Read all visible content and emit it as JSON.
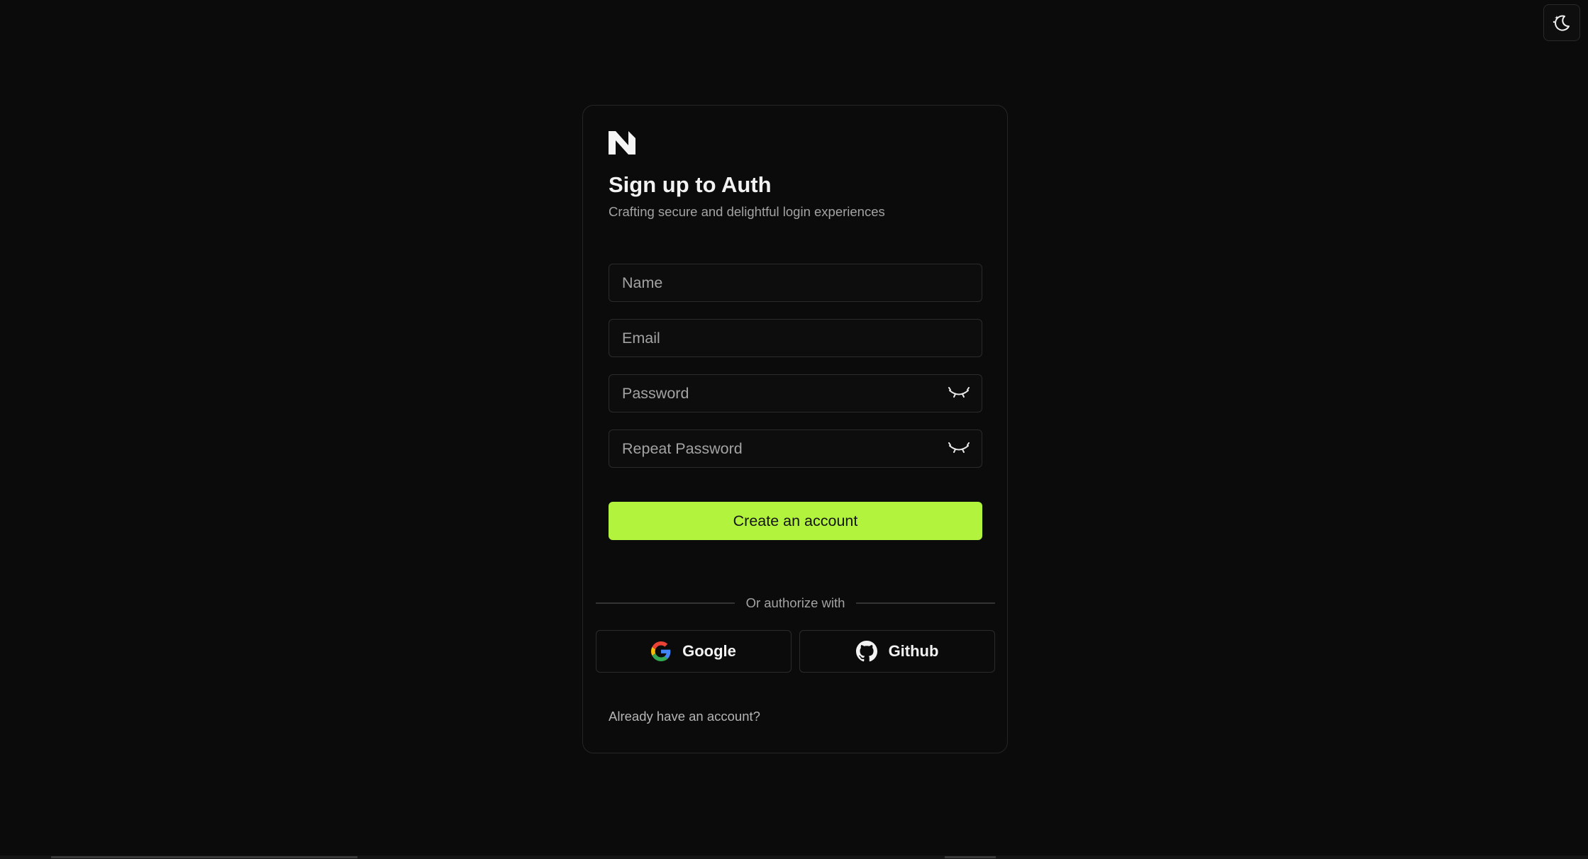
{
  "theme_toggle": {
    "icon": "moon-stars-icon"
  },
  "card": {
    "logo": {
      "icon": "brand-logo-icon"
    },
    "title": "Sign up to Auth",
    "subtitle": "Crafting secure and delightful login experiences"
  },
  "form": {
    "name": {
      "placeholder": "Name",
      "value": ""
    },
    "email": {
      "placeholder": "Email",
      "value": ""
    },
    "password": {
      "placeholder": "Password",
      "value": "",
      "toggle_icon": "eye-closed-icon"
    },
    "repeat_password": {
      "placeholder": "Repeat Password",
      "value": "",
      "toggle_icon": "eye-closed-icon"
    },
    "submit_label": "Create an account"
  },
  "oauth": {
    "divider_text": "Or authorize with",
    "providers": [
      {
        "label": "Google",
        "icon": "google-icon"
      },
      {
        "label": "Github",
        "icon": "github-icon"
      }
    ]
  },
  "footer": {
    "signin_text": "Already have an account?"
  },
  "colors": {
    "background": "#0b0b0b",
    "accent": "#b2f33e",
    "border": "#2b2b2b",
    "muted_text": "#a3a3a3"
  }
}
